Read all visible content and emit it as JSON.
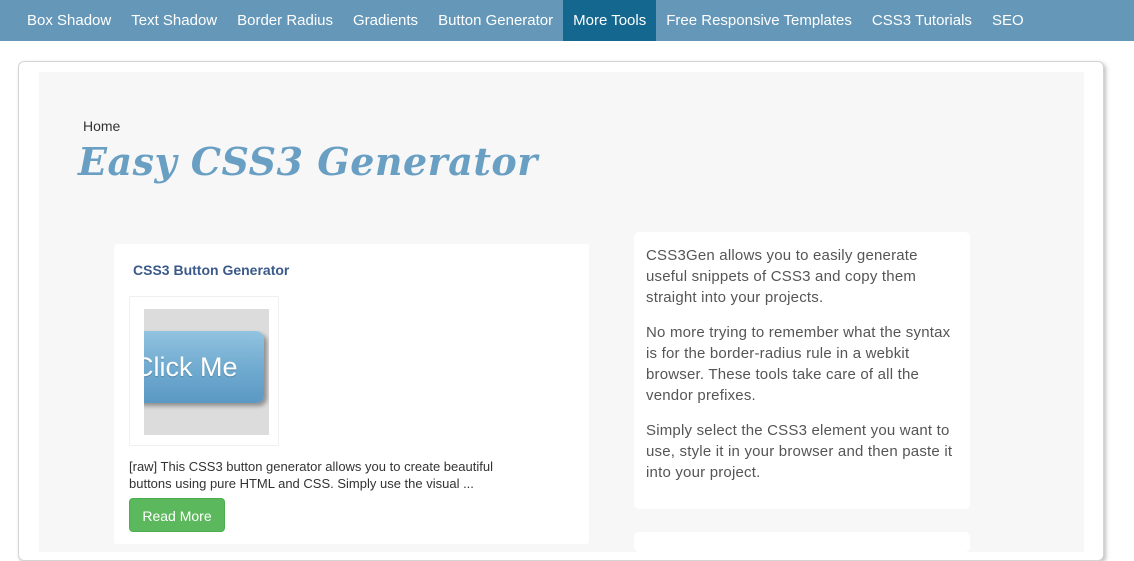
{
  "nav": {
    "items": [
      {
        "label": "Box Shadow",
        "active": false
      },
      {
        "label": "Text Shadow",
        "active": false
      },
      {
        "label": "Border Radius",
        "active": false
      },
      {
        "label": "Gradients",
        "active": false
      },
      {
        "label": "Button Generator",
        "active": false
      },
      {
        "label": "More Tools",
        "active": true
      },
      {
        "label": "Free Responsive Templates",
        "active": false
      },
      {
        "label": "CSS3 Tutorials",
        "active": false
      },
      {
        "label": "SEO",
        "active": false
      }
    ],
    "colors": {
      "bar": "#6497b8",
      "active": "#14688f"
    }
  },
  "breadcrumb": "Home",
  "page_title": "Easy CSS3 Generator",
  "left_card": {
    "title": "CSS3 Button Generator",
    "thumbnail_text": "Click Me",
    "description": "[raw] This CSS3 button generator allows you to create beautiful buttons using pure HTML and CSS. Simply use the visual ...",
    "read_more_label": "Read More",
    "button_color": "#5cb85c"
  },
  "right_card": {
    "paragraphs": [
      "CSS3Gen allows you to easily generate useful snippets of CSS3 and copy them straight into your projects.",
      "No more trying to remember what the syntax is for the border-radius rule in a webkit browser. These tools take care of all the vendor prefixes.",
      "Simply select the CSS3 element you want to use, style it in your browser and then paste it into your project."
    ]
  }
}
